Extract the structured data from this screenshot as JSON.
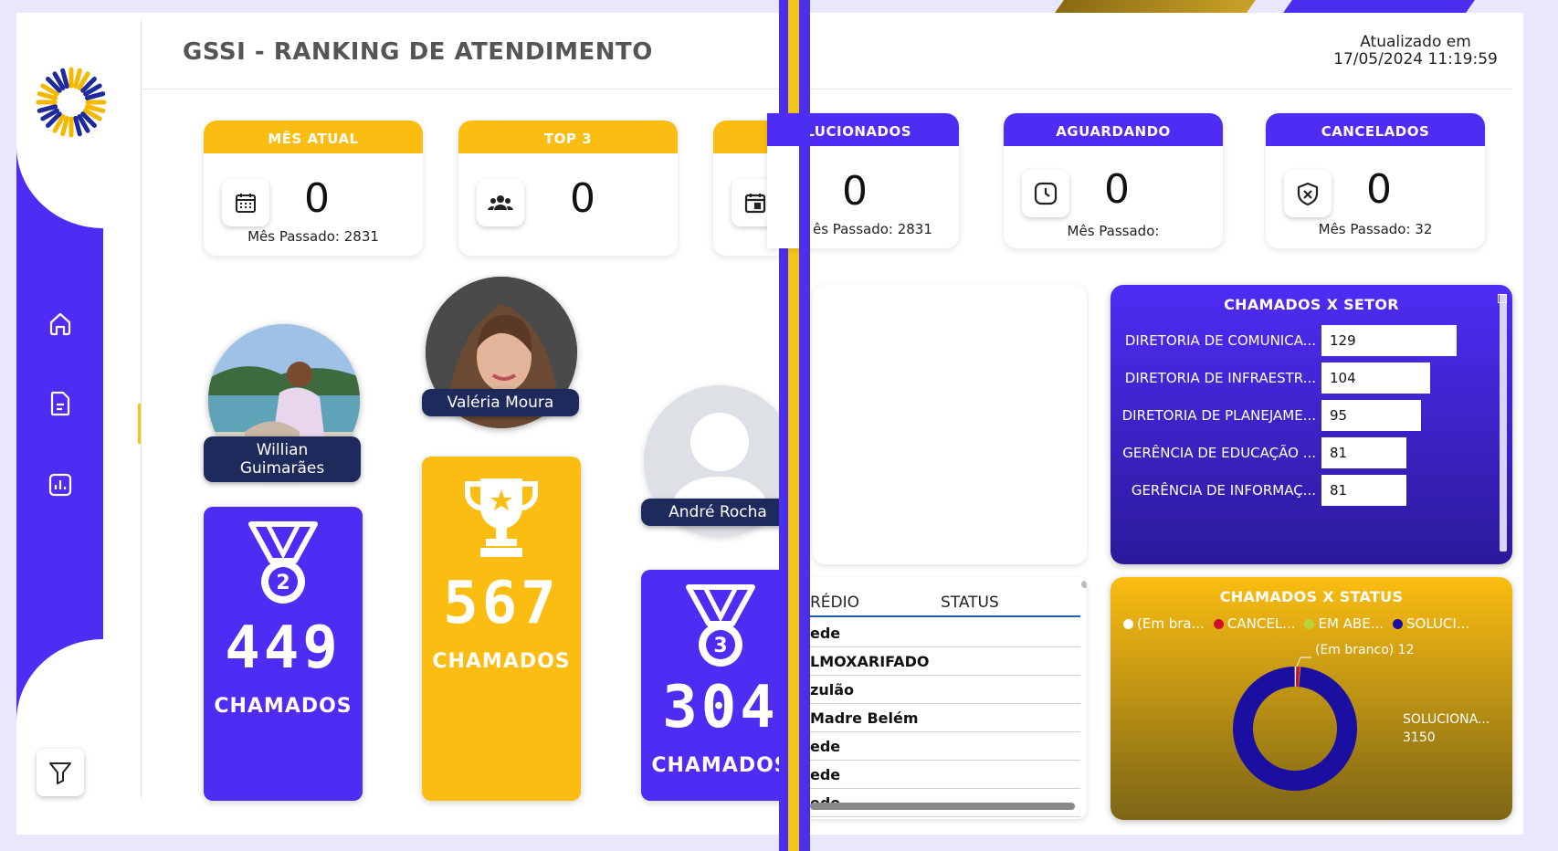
{
  "header": {
    "title": "GSSI - RANKING DE ATENDIMENTO",
    "updated_label": "Atualizado em",
    "updated_value": "17/05/2024 11:19:59"
  },
  "sidebar": {
    "items": [
      {
        "name": "home-icon"
      },
      {
        "name": "document-icon"
      },
      {
        "name": "chart-icon"
      }
    ],
    "filter_icon": "filter-icon"
  },
  "kpis_left": [
    {
      "label": "MÊS ATUAL",
      "value": "0",
      "sub": "Mês Passado: 2831",
      "icon": "calendar-icon"
    },
    {
      "label": "TOP 3",
      "value": "0",
      "sub": "",
      "icon": "group-icon"
    },
    {
      "label": "",
      "value": "",
      "sub": "",
      "icon": "calendar-event-icon"
    }
  ],
  "kpis_right": [
    {
      "label": "LUCIONADOS",
      "value": "0",
      "sub": "ês Passado: 2831",
      "icon": ""
    },
    {
      "label": "AGUARDANDO",
      "value": "0",
      "sub": "Mês Passado:",
      "icon": "clock-icon"
    },
    {
      "label": "CANCELADOS",
      "value": "0",
      "sub": "Mês Passado: 32",
      "icon": "shield-x-icon"
    }
  ],
  "podium": {
    "second": {
      "name": "Willian Guimarães",
      "value": "449",
      "label": "CHAMADOS",
      "rank": "2"
    },
    "first": {
      "name": "Valéria Moura",
      "value": "567",
      "label": "CHAMADOS"
    },
    "third": {
      "name": "André Rocha",
      "value": "304",
      "label": "CHAMADOS",
      "rank": "3"
    }
  },
  "setor_chart": {
    "title": "CHAMADOS X SETOR",
    "rows": [
      {
        "label": "DIRETORIA DE COMUNICA...",
        "value": "129"
      },
      {
        "label": "DIRETORIA DE INFRAESTR...",
        "value": "104"
      },
      {
        "label": "DIRETORIA DE PLANEJAME...",
        "value": "95"
      },
      {
        "label": "GERÊNCIA DE EDUCAÇÃO ...",
        "value": "81"
      },
      {
        "label": "GERÊNCIA DE INFORMAÇ...",
        "value": "81"
      }
    ]
  },
  "table": {
    "col1": "RÉDIO",
    "col2": "STATUS",
    "rows": [
      "ede",
      "LMOXARIFADO",
      "zulão",
      "Madre Belém",
      "ede",
      "ede",
      "ede"
    ]
  },
  "status_chart": {
    "title": "CHAMADOS X STATUS",
    "legend": [
      {
        "label": "(Em bra...",
        "color": "#ffffff"
      },
      {
        "label": "CANCEL...",
        "color": "#d0102a"
      },
      {
        "label": "EM ABE...",
        "color": "#b8d43a"
      },
      {
        "label": "SOLUCI...",
        "color": "#1a0fa0"
      }
    ],
    "label_top": "(Em branco) 12",
    "label_right_1": "SOLUCIONA...",
    "label_right_2": "3150"
  },
  "chart_data": {
    "type": "pie",
    "title": "CHAMADOS X STATUS",
    "categories": [
      "(Em branco)",
      "CANCELADOS",
      "EM ABERTO",
      "SOLUCIONADOS"
    ],
    "values": [
      12,
      32,
      4,
      3150
    ]
  }
}
